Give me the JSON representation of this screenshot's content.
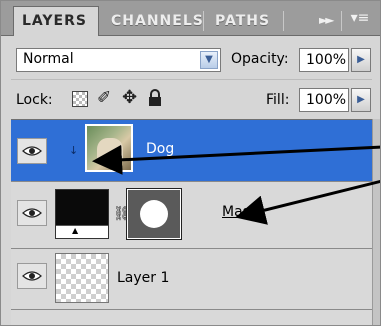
{
  "tabs": [
    {
      "label": "LAYERS",
      "active": true
    },
    {
      "label": "CHANNELS",
      "active": false
    },
    {
      "label": "PATHS",
      "active": false
    }
  ],
  "tabbar": {
    "forward_glyph": "►►",
    "menu_glyph": "▾≡"
  },
  "blend": {
    "value": "Normal",
    "arrow_glyph": "▼"
  },
  "opacity": {
    "label": "Opacity:",
    "value": "100%",
    "stepper_glyph": "▶"
  },
  "lock": {
    "label": "Lock:"
  },
  "fill": {
    "label": "Fill:",
    "value": "100%",
    "stepper_glyph": "▶"
  },
  "layers": [
    {
      "name": "Dog",
      "selected": true,
      "visible": true,
      "clipped": true
    },
    {
      "name": "Mask",
      "selected": false,
      "visible": true,
      "has_layer_mask": true
    },
    {
      "name": "Layer 1",
      "selected": false,
      "visible": true,
      "transparent": true
    }
  ],
  "colors": {
    "selection": "#2f6fd6",
    "panel": "#d6d6d6",
    "tabbar": "#9c9c9c",
    "arrow": "#000000"
  }
}
